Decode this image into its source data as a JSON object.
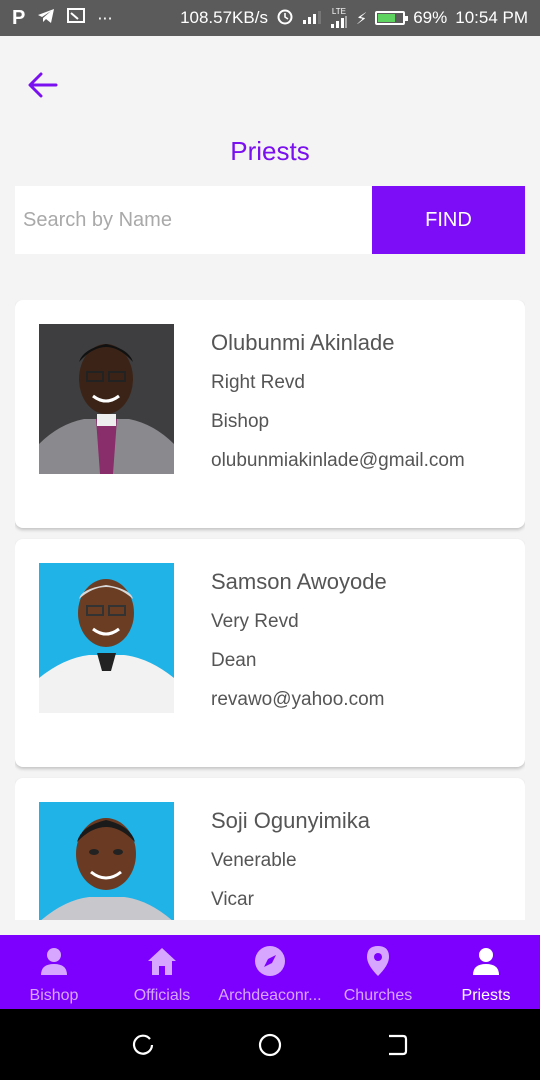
{
  "status_bar": {
    "speed": "108.57KB/s",
    "network_type": "LTE",
    "battery": "69%",
    "battery_level": 0.69,
    "time": "10:54 PM"
  },
  "header": {
    "title": "Priests"
  },
  "search": {
    "placeholder": "Search by Name",
    "value": "",
    "button_label": "FIND"
  },
  "priests": [
    {
      "name": "Olubunmi Akinlade",
      "title": "Right Revd",
      "role": "Bishop",
      "email": "olubunmiakinlade@gmail.com"
    },
    {
      "name": "Samson Awoyode",
      "title": "Very Revd",
      "role": "Dean",
      "email": "revawo@yahoo.com"
    },
    {
      "name": "Soji Ogunyimika",
      "title": "Venerable",
      "role": "Vicar",
      "email": ""
    }
  ],
  "bottom_nav": {
    "items": [
      {
        "label": "Bishop",
        "icon": "person-icon"
      },
      {
        "label": "Officials",
        "icon": "home-icon"
      },
      {
        "label": "Archdeaconr...",
        "icon": "compass-icon"
      },
      {
        "label": "Churches",
        "icon": "location-pin-icon"
      },
      {
        "label": "Priests",
        "icon": "person-icon"
      }
    ],
    "active_index": 4
  },
  "colors": {
    "accent": "#7d00ff",
    "title": "#7a0ff0",
    "nav_inactive": "#d7a6ff"
  }
}
